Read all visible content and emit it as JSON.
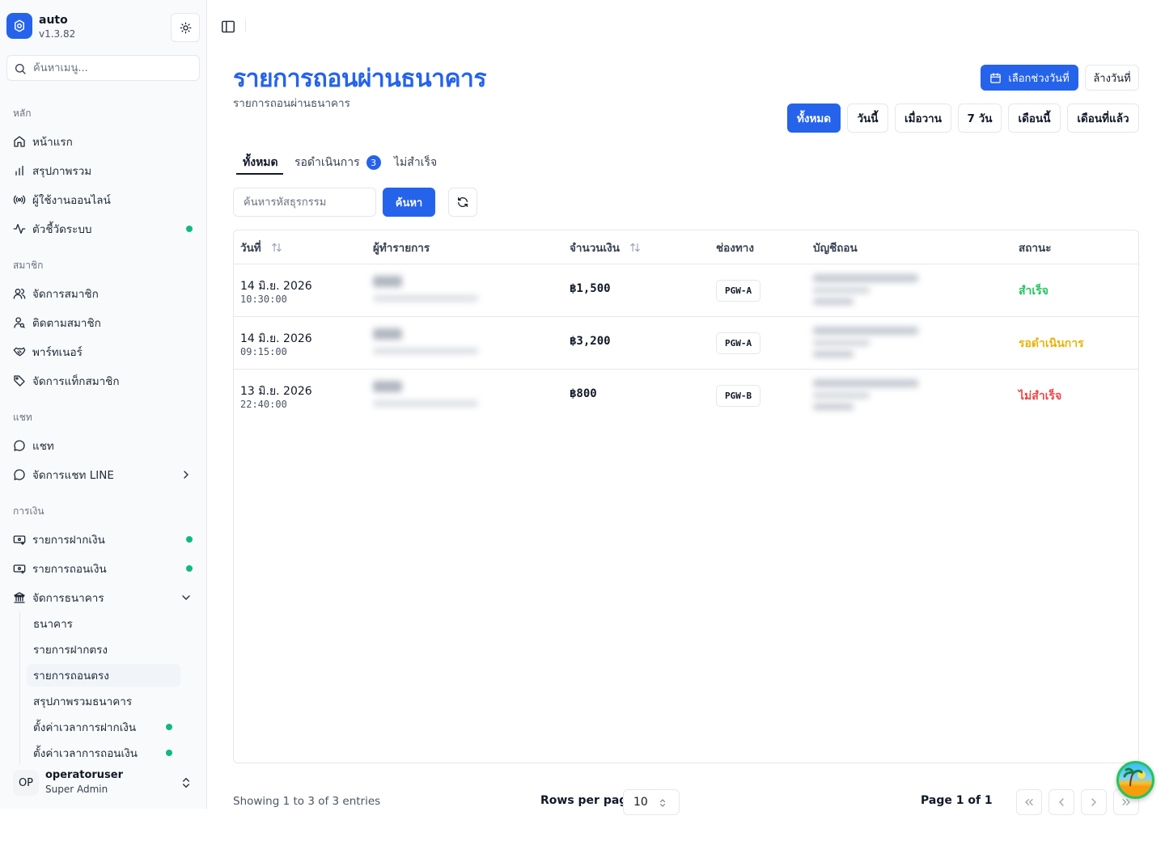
{
  "app": {
    "name": "auto",
    "version": "v1.3.82"
  },
  "sidebar": {
    "search_placeholder": "ค้นหาเมนู...",
    "sections": {
      "main": "หลัก",
      "members": "สมาชิก",
      "chat": "แชท",
      "finance": "การเงิน"
    },
    "items": {
      "home": "หน้าแรก",
      "overview": "สรุปภาพรวม",
      "online_users": "ผู้ใช้งานออนไลน์",
      "system_metrics": "ตัวชี้วัดระบบ",
      "manage_members": "จัดการสมาชิก",
      "track_members": "ติดตามสมาชิก",
      "partners": "พาร์ทเนอร์",
      "member_tags": "จัดการแท็กสมาชิก",
      "chat": "แชท",
      "line_chat": "จัดการแชท LINE",
      "deposits": "รายการฝากเงิน",
      "withdrawals": "รายการถอนเงิน",
      "bank_management": "จัดการธนาคาร"
    },
    "bank_sub": {
      "banks": "ธนาคาร",
      "direct_deposits": "รายการฝากตรง",
      "direct_withdrawals": "รายการถอนตรง",
      "bank_overview": "สรุปภาพรวมธนาคาร",
      "deposit_time": "ตั้งค่าเวลาการฝากเงิน",
      "withdraw_time": "ตั้งค่าเวลาการถอนเงิน"
    },
    "user": {
      "initials": "OP",
      "name": "operatoruser",
      "role": "Super Admin"
    }
  },
  "header": {
    "title": "รายการถอนผ่านธนาคาร",
    "subtitle": "รายการถอนผ่านธนาคาร",
    "date_range_button": "เลือกช่วงวันที่",
    "clear_date_button": "ล้างวันที่",
    "period_filters": [
      "ทั้งหมด",
      "วันนี้",
      "เมื่อวาน",
      "7 วัน",
      "เดือนนี้",
      "เดือนที่แล้ว"
    ]
  },
  "tabs": {
    "all": "ทั้งหมด",
    "pending": "รอดำเนินการ",
    "pending_count": "3",
    "failed": "ไม่สำเร็จ"
  },
  "search": {
    "placeholder": "ค้นหารหัสธุรกรรม",
    "button": "ค้นหา"
  },
  "table": {
    "columns": [
      "วันที่",
      "ผู้ทำรายการ",
      "จำนวนเงิน",
      "ช่องทาง",
      "บัญชีถอน",
      "สถานะ"
    ],
    "rows": [
      {
        "date": "14 มิ.ย. 2026",
        "time": "10:30:00",
        "amount": "฿1,500",
        "channel": "PGW-A",
        "status": "สำเร็จ",
        "status_color": "#22c55e"
      },
      {
        "date": "14 มิ.ย. 2026",
        "time": "09:15:00",
        "amount": "฿3,200",
        "channel": "PGW-A",
        "status": "รอดำเนินการ",
        "status_color": "#eab308"
      },
      {
        "date": "13 มิ.ย. 2026",
        "time": "22:40:00",
        "amount": "฿800",
        "channel": "PGW-B",
        "status": "ไม่สำเร็จ",
        "status_color": "#ef4444"
      }
    ]
  },
  "footer": {
    "showing": "Showing 1 to 3 of 3 entries",
    "rows_per_page_label": "Rows per page",
    "rows_per_page_value": "10",
    "page_info": "Page 1 of 1"
  },
  "colors": {
    "accent": "#2563eb",
    "online_dot": "#10b981"
  }
}
